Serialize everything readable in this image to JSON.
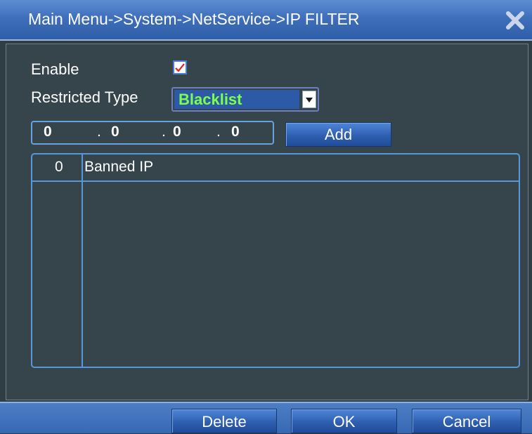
{
  "window": {
    "title": "Main Menu->System->NetService->IP FILTER",
    "close_icon": "close-x-icon"
  },
  "form": {
    "enable_label": "Enable",
    "enable_checked": true,
    "restricted_type_label": "Restricted Type",
    "restricted_type_value": "Blacklist",
    "ip_segments": [
      "0",
      "0",
      "0",
      "0"
    ],
    "ip_separator": ".",
    "add_button": "Add"
  },
  "table": {
    "count": "0",
    "column_header": "Banned IP",
    "rows": []
  },
  "footer": {
    "delete_button": "Delete",
    "ok_button": "OK",
    "cancel_button": "Cancel"
  },
  "colors": {
    "title_bar": "#3f6fba",
    "panel_bg": "#36444c",
    "accent_border": "#5a96dc",
    "select_text": "#7cff4a",
    "checkmark": "#e02020"
  }
}
